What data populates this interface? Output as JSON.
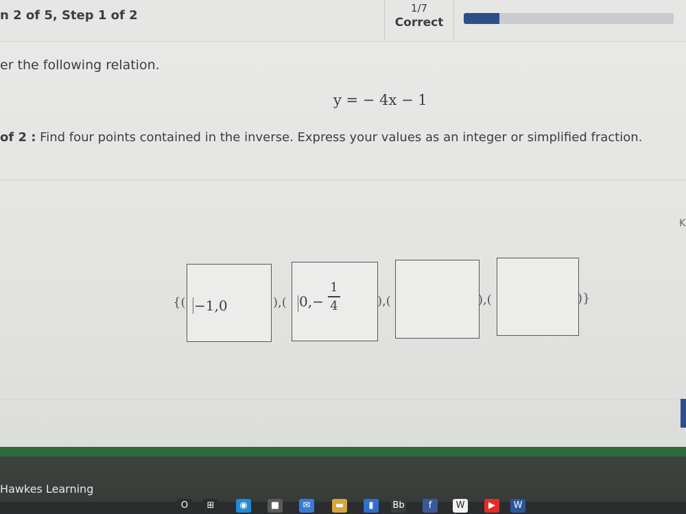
{
  "header": {
    "step_title": "n 2 of 5, Step 1 of 2",
    "score_fraction": "1/7",
    "score_label": "Correct",
    "progress_fraction": 0.17
  },
  "question": {
    "prompt": "er the following relation.",
    "equation": "y = − 4x − 1",
    "step_prefix": "of 2 :",
    "step_text": " Find four points contained in the inverse. Express your values as an integer or simplified fraction."
  },
  "answer": {
    "open": "{(",
    "sep1": "),(",
    "sep2": "),(",
    "sep3": "),(",
    "close": ")}",
    "box1_value": "−1,0",
    "box2_value": "0,−",
    "box2_numerator": "1",
    "box2_denominator": "4",
    "box3_value": "",
    "box4_value": ""
  },
  "edge_letter": "K",
  "footer": {
    "brand": "Hawkes Learning"
  },
  "taskbar": {
    "icons": [
      {
        "name": "search-icon",
        "glyph": "O",
        "color": "#2a2c2e"
      },
      {
        "name": "task-view-icon",
        "glyph": "⊞",
        "color": "#2a2c2e"
      },
      {
        "name": "edge-browser-icon",
        "glyph": "◉",
        "color": "#1f8ad6"
      },
      {
        "name": "store-icon",
        "glyph": "■",
        "color": "#5b5b5b"
      },
      {
        "name": "mail-icon",
        "glyph": "✉",
        "color": "#3a7bd5"
      },
      {
        "name": "file-explorer-icon",
        "glyph": "▬",
        "color": "#d9a53a"
      },
      {
        "name": "bookmark-icon",
        "glyph": "▮",
        "color": "#2f6fd0"
      },
      {
        "name": "blackboard-icon",
        "glyph": "Bb",
        "color": "#3b3b3b"
      },
      {
        "name": "facebook-icon",
        "glyph": "f",
        "color": "#3b5998"
      },
      {
        "name": "wikipedia-icon",
        "glyph": "W",
        "color": "#f2f2f2"
      },
      {
        "name": "youtube-icon",
        "glyph": "▶",
        "color": "#e52d27"
      },
      {
        "name": "word-icon",
        "glyph": "W",
        "color": "#2b579a"
      }
    ]
  }
}
